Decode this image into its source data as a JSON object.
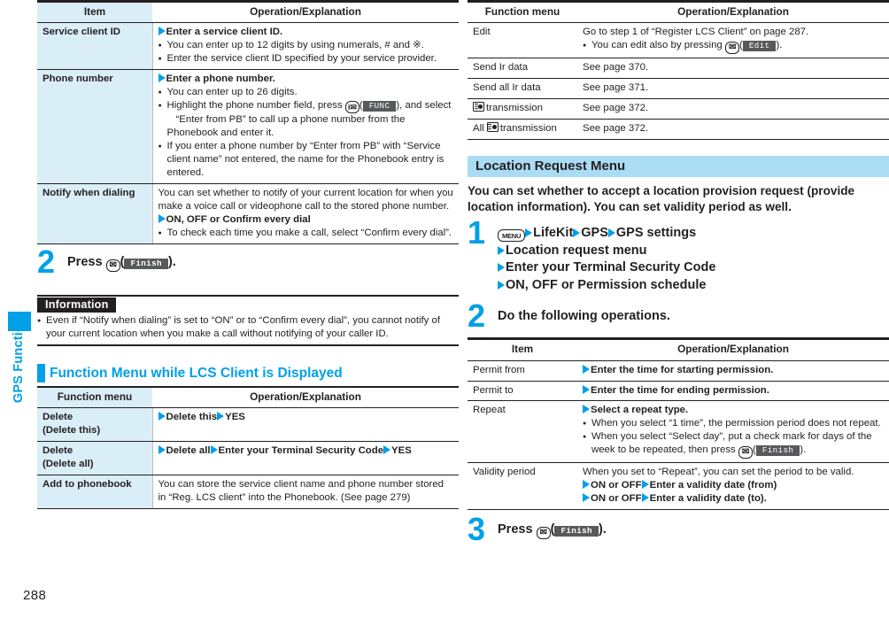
{
  "page": {
    "number": "288",
    "side_tab_label": "GPS Function"
  },
  "left_column": {
    "table_lcs_client": {
      "headers": [
        "Item",
        "Operation/Explanation"
      ],
      "rows": [
        {
          "item": "Service client ID",
          "op_lead": "Enter a service client ID.",
          "bullets": [
            "You can enter up to 12 digits by using numerals, # and ※.",
            "Enter the service client ID specified by your service provider."
          ]
        },
        {
          "item": "Phone number",
          "op_lead": "Enter a phone number.",
          "bullets": [
            "You can enter up to 26 digits.",
            "Highlight the phone number field, press",
            "“Enter from PB” to call up a phone number from the Phonebook and enter it.",
            "If you enter a phone number by “Enter from PB” with “Service client name” not entered, the name for the Phonebook entry is entered."
          ],
          "func_key_glyph": "i✉",
          "func_softkey": "FUNC",
          "bullet2_tail": ", and select"
        },
        {
          "item": "Notify when dialing",
          "text": "You can set whether to notify of your current location for when you make a voice call or videophone call to the stored phone number.",
          "op_lead": "ON, OFF or Confirm every dial",
          "bullets": [
            "To check each time you make a call, select “Confirm every dial”."
          ]
        }
      ]
    },
    "step2": {
      "number": "2",
      "text_before": "Press",
      "key": "✉",
      "softkey": "Finish",
      "text_after": ")."
    },
    "information": {
      "title": "Information",
      "bullets": [
        "Even if “Notify when dialing” is set to “ON” or to “Confirm every dial”, you cannot notify of your current location when you make a call without notifying of your caller ID."
      ]
    },
    "section_function_menu": {
      "title": "Function Menu while LCS Client is Displayed",
      "table": {
        "headers": [
          "Function menu",
          "Operation/Explanation"
        ],
        "rows": [
          {
            "item_line1": "Delete",
            "item_line2": "(Delete this)",
            "ops": [
              "Delete this",
              "YES"
            ]
          },
          {
            "item_line1": "Delete",
            "item_line2": "(Delete all)",
            "ops": [
              "Delete all",
              "Enter your Terminal Security Code",
              "YES"
            ]
          },
          {
            "item_line1": "Add to phonebook",
            "item_line2": "",
            "text": "You can store the service client name and phone number stored in “Reg. LCS client” into the Phonebook. (See page 279)"
          }
        ]
      }
    }
  },
  "right_column": {
    "table_function_menu": {
      "headers": [
        "Function menu",
        "Operation/Explanation"
      ],
      "rows": [
        {
          "item": "Edit",
          "text": "Go to step 1 of “Register LCS Client” on page 287.",
          "bullet_prefix": "You can edit also by pressing",
          "bullet_key": "✉",
          "bullet_softkey": "Edit",
          "bullet_suffix": ")."
        },
        {
          "item": "Send Ir data",
          "text": "See page 370."
        },
        {
          "item": "Send all Ir data",
          "text": "See page 371."
        },
        {
          "item": "transmission",
          "icon": "ic-card-icon",
          "icon_first": true,
          "text": "See page 372."
        },
        {
          "item": "transmission",
          "icon": "ic-card-icon",
          "prefix": "All",
          "text": "See page 372."
        }
      ]
    },
    "section_location_request": {
      "title": "Location Request Menu",
      "intro": "You can set whether to accept a location provision request (provide location information). You can set validity period as well.",
      "step1": {
        "number": "1",
        "menu_key": "MENU",
        "lines": [
          [
            "LifeKit",
            "GPS",
            "GPS settings"
          ],
          [
            "Location request menu"
          ],
          [
            "Enter your Terminal Security Code"
          ],
          [
            "ON, OFF or Permission schedule"
          ]
        ]
      },
      "step2": {
        "number": "2",
        "text": "Do the following operations."
      },
      "table": {
        "headers": [
          "Item",
          "Operation/Explanation"
        ],
        "rows": [
          {
            "item": "Permit from",
            "op_lead": "Enter the time for starting permission."
          },
          {
            "item": "Permit to",
            "op_lead": "Enter the time for ending permission."
          },
          {
            "item": "Repeat",
            "op_lead": "Select a repeat type.",
            "bullets": [
              "When you select “1 time”, the permission period does not repeat.",
              "When you select “Select day”, put a check mark for days of the week to be repeated, then press"
            ],
            "bullet_key": "✉",
            "bullet_softkey": "Finish",
            "bullet_suffix": ")."
          },
          {
            "item": "Validity period",
            "text": "When you set to “Repeat”, you can set the period to be valid.",
            "ops1": [
              "ON or OFF",
              "Enter a validity date (from)"
            ],
            "ops2": [
              "ON or OFF",
              "Enter a validity date (to)."
            ]
          }
        ]
      },
      "step3": {
        "number": "3",
        "text_before": "Press",
        "key": "✉",
        "softkey": "Finish",
        "text_after": ")."
      }
    }
  },
  "colors": {
    "accent": "#00a0e9",
    "table_header_fill": "#daeef8",
    "section_head_fill": "#aadcf4",
    "ink": "#231f20",
    "softkey_fill": "#58595b"
  }
}
